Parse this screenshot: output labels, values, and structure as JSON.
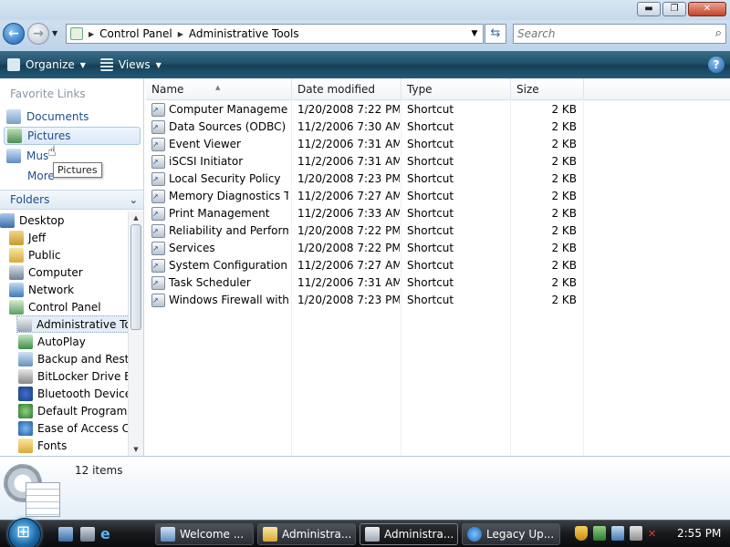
{
  "window": {
    "controls": {
      "minimize": "▬",
      "maximize": "❐",
      "close": "✕"
    }
  },
  "address": {
    "breadcrumbs": [
      "Control Panel",
      "Administrative Tools"
    ],
    "search_placeholder": "Search"
  },
  "toolbar": {
    "organize_label": "Organize",
    "views_label": "Views",
    "help_label": "?"
  },
  "nav": {
    "favorites_title": "Favorite Links",
    "favorites": [
      {
        "label": "Documents",
        "icon": "documents-icon"
      },
      {
        "label": "Pictures",
        "icon": "pictures-icon"
      },
      {
        "label": "Mus",
        "icon": "music-icon"
      },
      {
        "label": "More",
        "icon": ""
      }
    ],
    "tooltip": "Pictures",
    "folders_title": "Folders",
    "tree": [
      {
        "label": "Desktop",
        "icon": "desktop-icon"
      },
      {
        "label": "Jeff",
        "icon": "user-folder-icon"
      },
      {
        "label": "Public",
        "icon": "folder-icon"
      },
      {
        "label": "Computer",
        "icon": "computer-icon"
      },
      {
        "label": "Network",
        "icon": "network-icon"
      },
      {
        "label": "Control Panel",
        "icon": "control-panel-icon"
      },
      {
        "label": "Administrative Too",
        "icon": "administrative-tools-icon"
      },
      {
        "label": "AutoPlay",
        "icon": "autoplay-icon"
      },
      {
        "label": "Backup and Restor",
        "icon": "backup-icon"
      },
      {
        "label": "BitLocker Drive Enc",
        "icon": "bitlocker-icon"
      },
      {
        "label": "Bluetooth Devices",
        "icon": "bluetooth-icon"
      },
      {
        "label": "Default Programs",
        "icon": "default-programs-icon"
      },
      {
        "label": "Ease of Access Cen",
        "icon": "ease-of-access-icon"
      },
      {
        "label": "Fonts",
        "icon": "fonts-folder-icon"
      }
    ]
  },
  "list": {
    "columns": {
      "name": "Name",
      "date": "Date modified",
      "type": "Type",
      "size": "Size"
    },
    "rows": [
      {
        "name": "Computer Management",
        "date": "1/20/2008 7:22 PM",
        "type": "Shortcut",
        "size": "2 KB"
      },
      {
        "name": "Data Sources (ODBC)",
        "date": "11/2/2006 7:30 AM",
        "type": "Shortcut",
        "size": "2 KB"
      },
      {
        "name": "Event Viewer",
        "date": "11/2/2006 7:31 AM",
        "type": "Shortcut",
        "size": "2 KB"
      },
      {
        "name": "iSCSI Initiator",
        "date": "11/2/2006 7:31 AM",
        "type": "Shortcut",
        "size": "2 KB"
      },
      {
        "name": "Local Security Policy",
        "date": "1/20/2008 7:23 PM",
        "type": "Shortcut",
        "size": "2 KB"
      },
      {
        "name": "Memory Diagnostics T...",
        "date": "11/2/2006 7:27 AM",
        "type": "Shortcut",
        "size": "2 KB"
      },
      {
        "name": "Print Management",
        "date": "11/2/2006 7:33 AM",
        "type": "Shortcut",
        "size": "2 KB"
      },
      {
        "name": "Reliability and Perform...",
        "date": "1/20/2008 7:22 PM",
        "type": "Shortcut",
        "size": "2 KB"
      },
      {
        "name": "Services",
        "date": "1/20/2008 7:22 PM",
        "type": "Shortcut",
        "size": "2 KB"
      },
      {
        "name": "System Configuration",
        "date": "11/2/2006 7:27 AM",
        "type": "Shortcut",
        "size": "2 KB"
      },
      {
        "name": "Task Scheduler",
        "date": "11/2/2006 7:31 AM",
        "type": "Shortcut",
        "size": "2 KB"
      },
      {
        "name": "Windows Firewall with ...",
        "date": "1/20/2008 7:23 PM",
        "type": "Shortcut",
        "size": "2 KB"
      }
    ]
  },
  "details": {
    "item_count": "12 items"
  },
  "taskbar": {
    "tasks": [
      {
        "label": "Welcome ..."
      },
      {
        "label": "Administra..."
      },
      {
        "label": "Administra..."
      },
      {
        "label": "Legacy Up..."
      }
    ],
    "clock": "2:55 PM"
  }
}
